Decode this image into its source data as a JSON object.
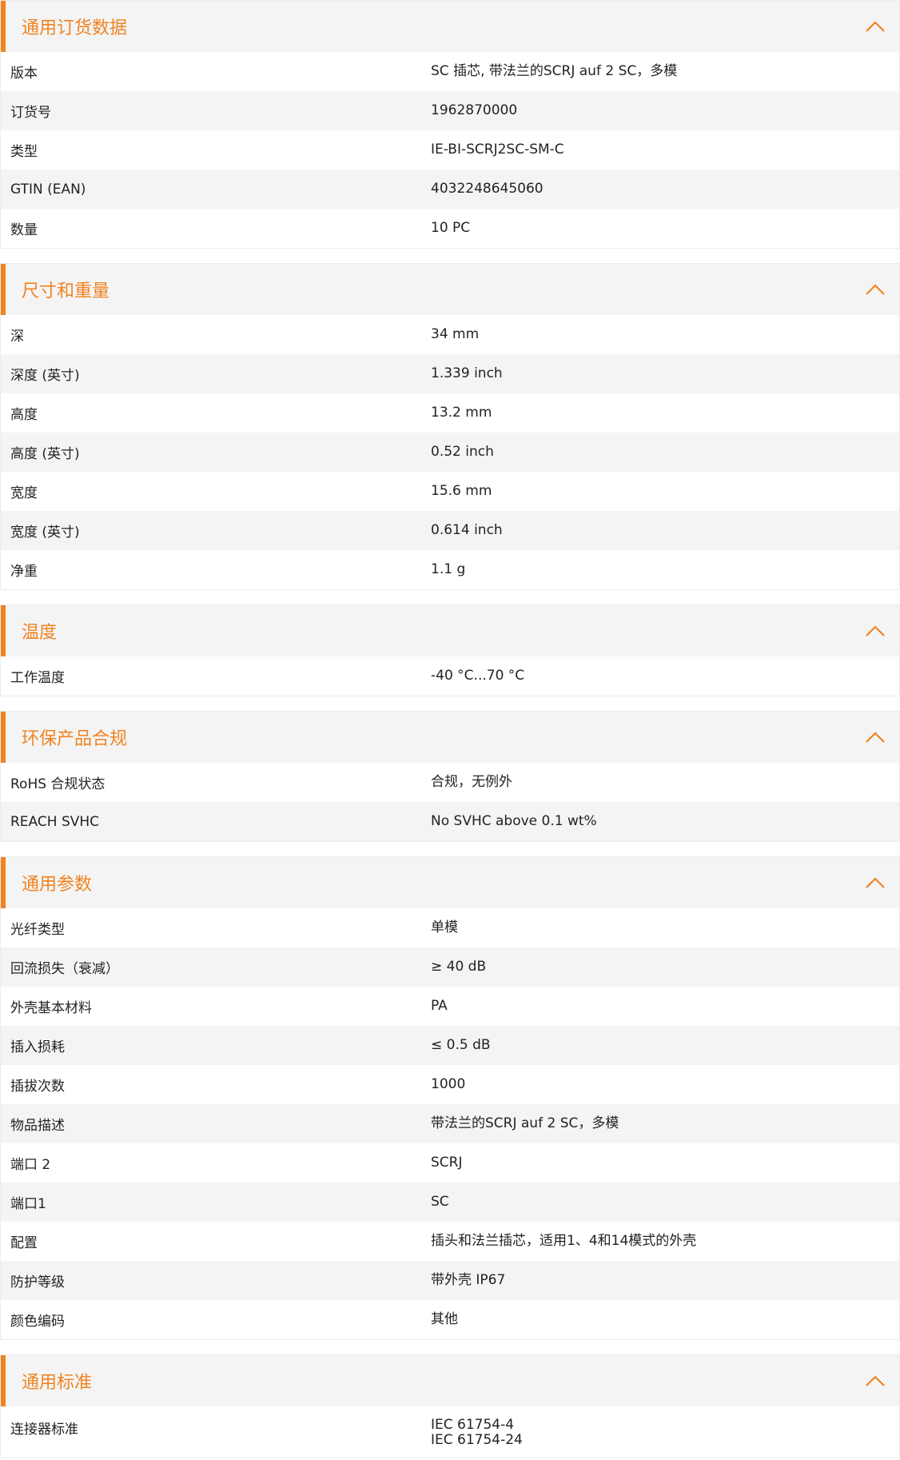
{
  "sections": [
    {
      "title": "通用订货数据",
      "rows": [
        {
          "label": "版本",
          "value": [
            "SC 插芯, 带法兰的SCRJ auf 2 SC，多模"
          ]
        },
        {
          "label": "订货号",
          "value": [
            "1962870000"
          ]
        },
        {
          "label": "类型",
          "value": [
            "IE-BI-SCRJ2SC-SM-C"
          ]
        },
        {
          "label": "GTIN (EAN)",
          "value": [
            "4032248645060"
          ]
        },
        {
          "label": "数量",
          "value": [
            "10  PC"
          ]
        }
      ]
    },
    {
      "title": "尺寸和重量",
      "rows": [
        {
          "label": "深",
          "value": [
            "34  mm"
          ]
        },
        {
          "label": "深度 (英寸)",
          "value": [
            "1.339  inch"
          ]
        },
        {
          "label": "高度",
          "value": [
            "13.2  mm"
          ]
        },
        {
          "label": "高度 (英寸)",
          "value": [
            "0.52  inch"
          ]
        },
        {
          "label": "宽度",
          "value": [
            "15.6  mm"
          ]
        },
        {
          "label": "宽度 (英寸)",
          "value": [
            "0.614  inch"
          ]
        },
        {
          "label": "净重",
          "value": [
            "1.1  g"
          ]
        }
      ]
    },
    {
      "title": "温度",
      "rows": [
        {
          "label": "工作温度",
          "value": [
            "-40 °C...70 °C"
          ]
        }
      ]
    },
    {
      "title": "环保产品合规",
      "rows": [
        {
          "label": "RoHS 合规状态",
          "value": [
            "合规，无例外"
          ]
        },
        {
          "label": "REACH SVHC",
          "value": [
            "No SVHC above 0.1 wt%"
          ]
        }
      ]
    },
    {
      "title": "通用参数",
      "rows": [
        {
          "label": "光纤类型",
          "value": [
            "单模"
          ]
        },
        {
          "label": "回流损失（衰减）",
          "value": [
            "≥ 40 dB"
          ]
        },
        {
          "label": "外壳基本材料",
          "value": [
            "PA"
          ]
        },
        {
          "label": "插入损耗",
          "value": [
            "≤ 0.5 dB"
          ]
        },
        {
          "label": "插拔次数",
          "value": [
            "1000"
          ]
        },
        {
          "label": "物品描述",
          "value": [
            "带法兰的SCRJ auf 2 SC，多模"
          ]
        },
        {
          "label": "端口 2",
          "value": [
            "SCRJ"
          ]
        },
        {
          "label": "端口1",
          "value": [
            "SC"
          ]
        },
        {
          "label": "配置",
          "value": [
            "插头和法兰插芯，适用1、4和14模式的外壳"
          ]
        },
        {
          "label": "防护等级",
          "value": [
            "带外壳 IP67"
          ]
        },
        {
          "label": "颜色编码",
          "value": [
            "其他"
          ]
        }
      ]
    },
    {
      "title": "通用标准",
      "rows": [
        {
          "label": "连接器标准",
          "value": [
            "IEC 61754-4",
            "IEC 61754-24"
          ]
        }
      ]
    }
  ],
  "icons": {
    "collapse": "chevron-up-icon"
  },
  "colors": {
    "accent": "#f08321",
    "header_bg": "#f4f4f4",
    "stripe_bg": "#f4f4f4"
  }
}
